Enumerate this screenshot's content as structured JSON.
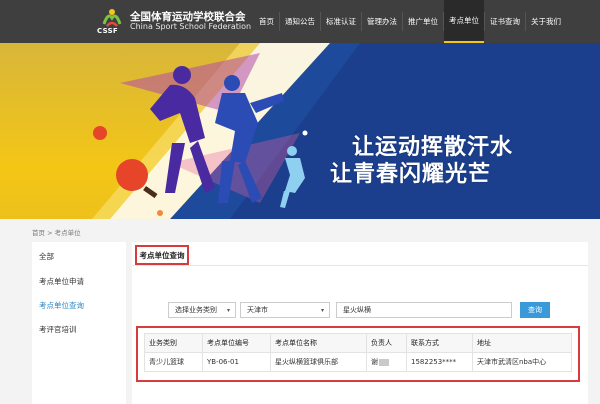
{
  "header": {
    "logo_text": "CSSF",
    "org_name_cn": "全国体育运动学校联合会",
    "org_name_en": "China Sport School Federation",
    "nav": [
      "首页",
      "通知公告",
      "标准认证",
      "管理办法",
      "推广单位",
      "考点单位",
      "证书查询",
      "关于我们"
    ],
    "active_nav": "考点单位"
  },
  "banner": {
    "slogan_line1": "让运动挥散汗水",
    "slogan_line2": "让青春闪耀光芒"
  },
  "breadcrumb": "首页 > 考点单位",
  "sidebar": {
    "items": [
      "全部",
      "考点单位申请",
      "考点单位查询",
      "考评官培训"
    ],
    "active": "考点单位查询"
  },
  "panel": {
    "title": "考点单位查询",
    "search": {
      "category_select": "选择业务类别",
      "city_select": "天津市",
      "keyword": "星火纵横",
      "button": "查询"
    },
    "table": {
      "headers": [
        "业务类别",
        "考点单位编号",
        "考点单位名称",
        "负责人",
        "联系方式",
        "地址"
      ],
      "rows": [
        [
          "青少儿篮球",
          "YB-06-01",
          "星火纵横篮球俱乐部",
          "谢",
          "1582253****",
          "天津市武清区nba中心"
        ]
      ]
    }
  },
  "colors": {
    "header_bg": "#3f3f3f",
    "banner_yellow": "#f3c616",
    "accent_blue": "#3a9ad9",
    "highlight_red": "#d93b3b"
  }
}
